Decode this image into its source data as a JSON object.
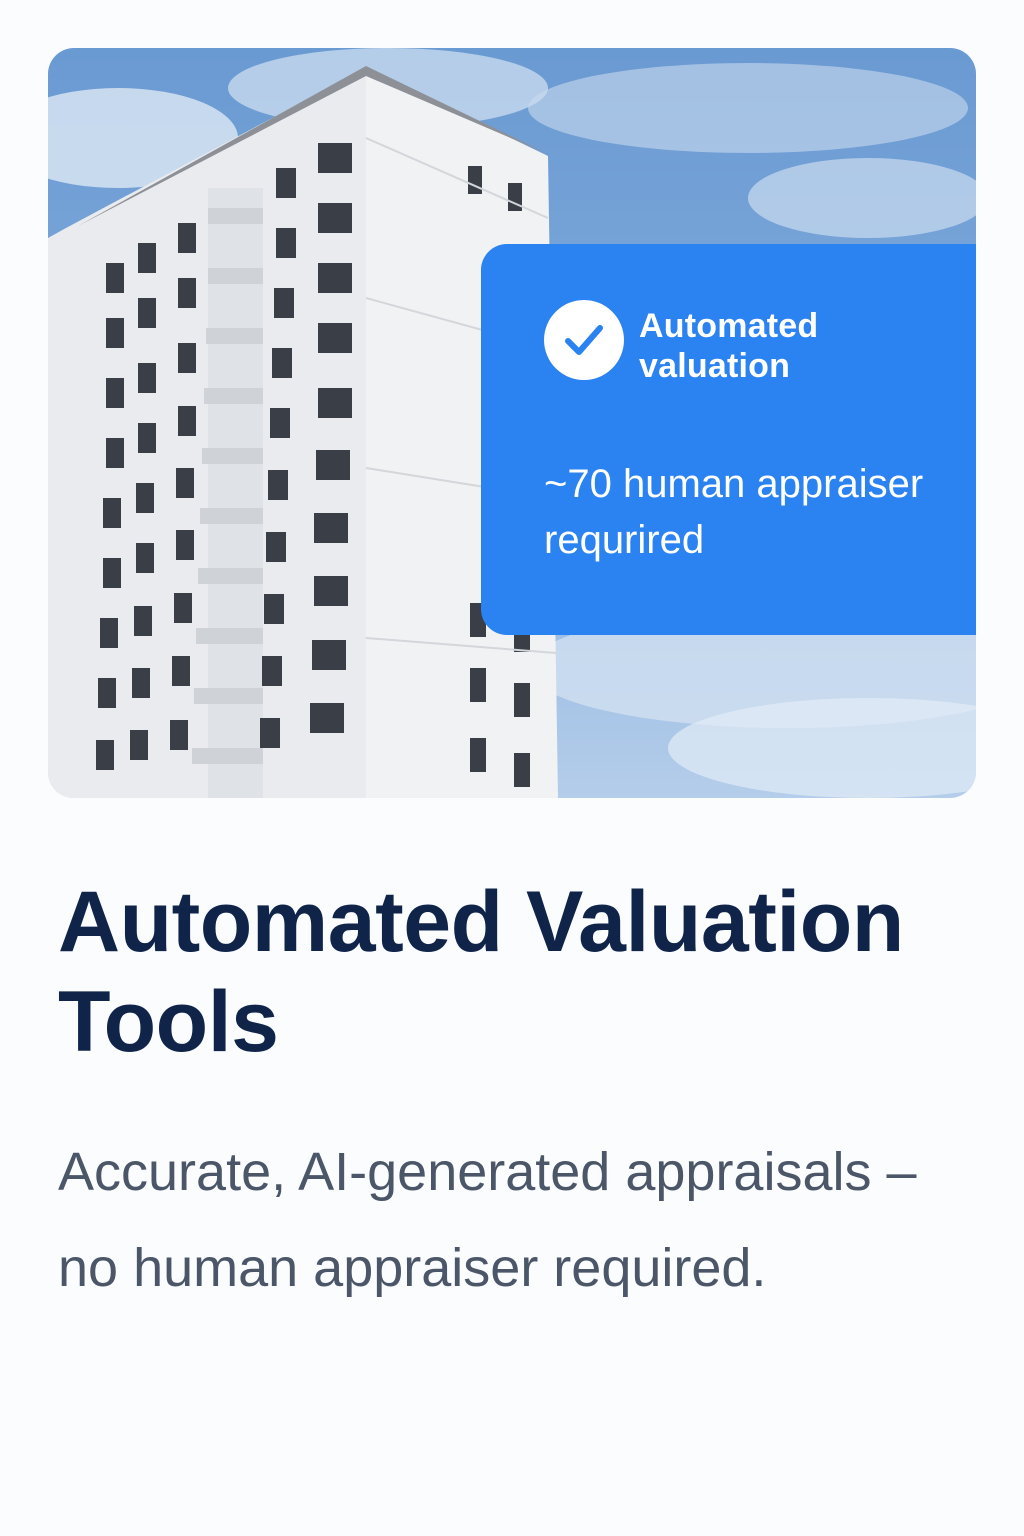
{
  "hero": {
    "badge": {
      "icon": "checkmark-icon",
      "label": "Automated valuation",
      "note": "~70 human appraiser requrired",
      "color": "#2b82f1"
    }
  },
  "heading": {
    "title": "Automated Valuation Tools",
    "subtitle": "Accurate, AI-generated appraisals – no human appraiser required."
  },
  "colors": {
    "title": "#10244a",
    "subtitle": "#4b5668",
    "accent": "#2b82f1"
  }
}
